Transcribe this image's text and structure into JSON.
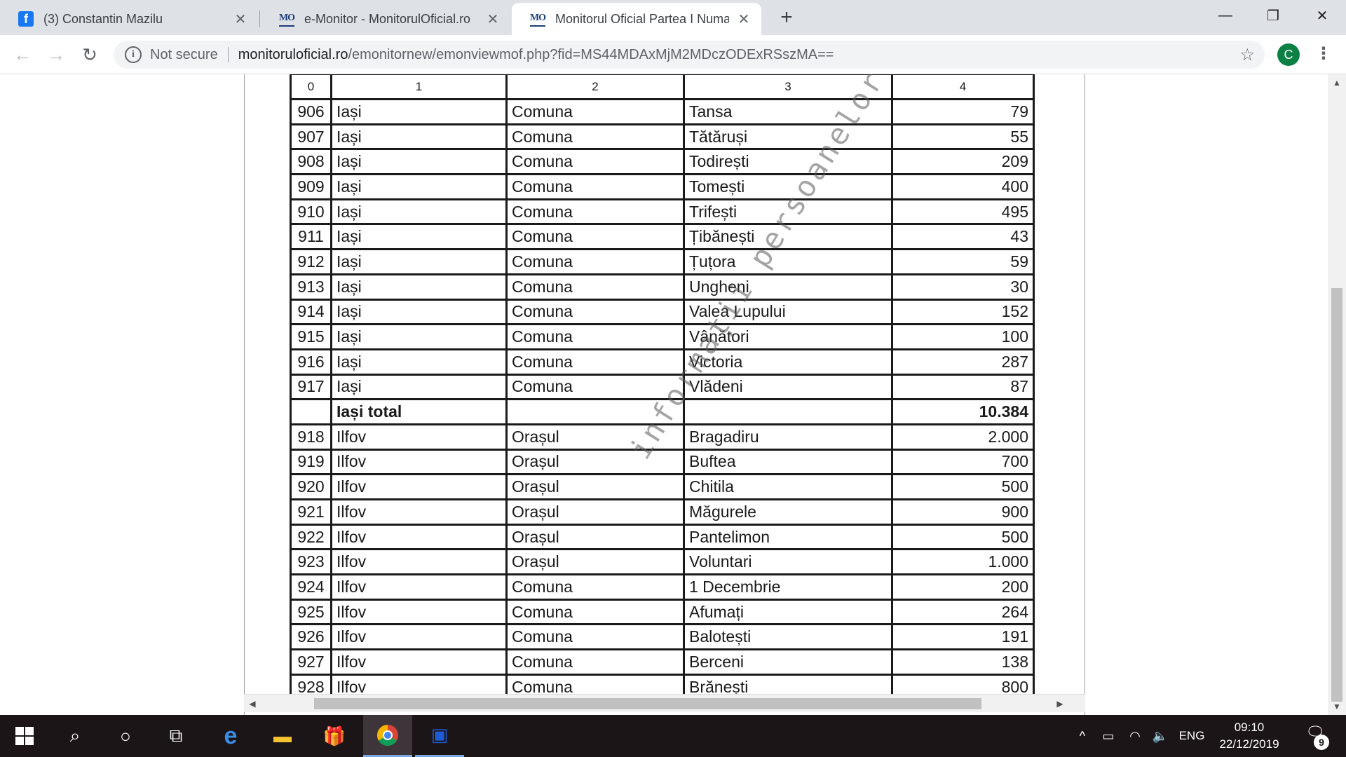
{
  "browser": {
    "tabs": [
      {
        "title": "(3) Constantin Mazilu",
        "icon": "facebook-icon",
        "active": false
      },
      {
        "title": "e-Monitor - MonitorulOficial.ro",
        "icon": "monitorul-oficial-icon",
        "active": false
      },
      {
        "title": "Monitorul Oficial Partea I Numar",
        "icon": "monitorul-oficial-icon",
        "active": true
      }
    ],
    "favicon_fb": "f",
    "favicon_mo": "MO",
    "new_tab": "+",
    "window_controls": {
      "minimize": "—",
      "restore": "❐",
      "close": "✕"
    },
    "toolbar": {
      "back": "←",
      "forward": "→",
      "reload": "↻",
      "security_icon": "i",
      "security_label": "Not secure",
      "url_domain": "monitoruloficial.ro",
      "url_path": "/emonitornew/emonviewmof.php?fid=MS44MDAxMjM2MDczODExRSszMA==",
      "bookmark": "☆",
      "profile_initial": "C",
      "menu": "⋮"
    }
  },
  "document": {
    "headers": [
      "0",
      "1",
      "2",
      "3",
      "4"
    ],
    "rows": [
      {
        "no": "906",
        "county": "Iași",
        "type": "Comuna",
        "locality": "Tansa",
        "value": "79"
      },
      {
        "no": "907",
        "county": "Iași",
        "type": "Comuna",
        "locality": "Tătăruși",
        "value": "55"
      },
      {
        "no": "908",
        "county": "Iași",
        "type": "Comuna",
        "locality": "Todirești",
        "value": "209"
      },
      {
        "no": "909",
        "county": "Iași",
        "type": "Comuna",
        "locality": "Tomești",
        "value": "400"
      },
      {
        "no": "910",
        "county": "Iași",
        "type": "Comuna",
        "locality": "Trifești",
        "value": "495"
      },
      {
        "no": "911",
        "county": "Iași",
        "type": "Comuna",
        "locality": "Țibănești",
        "value": "43"
      },
      {
        "no": "912",
        "county": "Iași",
        "type": "Comuna",
        "locality": "Țuțora",
        "value": "59"
      },
      {
        "no": "913",
        "county": "Iași",
        "type": "Comuna",
        "locality": "Ungheni",
        "value": "30"
      },
      {
        "no": "914",
        "county": "Iași",
        "type": "Comuna",
        "locality": "Valea Lupului",
        "value": "152"
      },
      {
        "no": "915",
        "county": "Iași",
        "type": "Comuna",
        "locality": "Vânători",
        "value": "100"
      },
      {
        "no": "916",
        "county": "Iași",
        "type": "Comuna",
        "locality": "Victoria",
        "value": "287"
      },
      {
        "no": "917",
        "county": "Iași",
        "type": "Comuna",
        "locality": "Vlădeni",
        "value": "87"
      },
      {
        "no": "",
        "county": "Iași total",
        "type": "",
        "locality": "",
        "value": "10.384",
        "total": true
      },
      {
        "no": "918",
        "county": "Ilfov",
        "type": "Orașul",
        "locality": "Bragadiru",
        "value": "2.000"
      },
      {
        "no": "919",
        "county": "Ilfov",
        "type": "Orașul",
        "locality": "Buftea",
        "value": "700"
      },
      {
        "no": "920",
        "county": "Ilfov",
        "type": "Orașul",
        "locality": "Chitila",
        "value": "500"
      },
      {
        "no": "921",
        "county": "Ilfov",
        "type": "Orașul",
        "locality": "Măgurele",
        "value": "900"
      },
      {
        "no": "922",
        "county": "Ilfov",
        "type": "Orașul",
        "locality": "Pantelimon",
        "value": "500"
      },
      {
        "no": "923",
        "county": "Ilfov",
        "type": "Orașul",
        "locality": "Voluntari",
        "value": "1.000"
      },
      {
        "no": "924",
        "county": "Ilfov",
        "type": "Comuna",
        "locality": "1 Decembrie",
        "value": "200"
      },
      {
        "no": "925",
        "county": "Ilfov",
        "type": "Comuna",
        "locality": "Afumați",
        "value": "264"
      },
      {
        "no": "926",
        "county": "Ilfov",
        "type": "Comuna",
        "locality": "Balotești",
        "value": "191"
      },
      {
        "no": "927",
        "county": "Ilfov",
        "type": "Comuna",
        "locality": "Berceni",
        "value": "138"
      },
      {
        "no": "928",
        "county": "Ilfov",
        "type": "Comuna",
        "locality": "Brănești",
        "value": "800"
      }
    ],
    "watermark": "informații persoanelor fizice"
  },
  "scrollbars": {
    "up": "▲",
    "down": "▼",
    "left": "◀",
    "right": "▶"
  },
  "taskbar": {
    "start_icon": "windows-start-icon",
    "search_glyph": "⌕",
    "cortana_glyph": "○",
    "taskview_glyph": "⧉",
    "edge_glyph": "e",
    "explorer_glyph": "▬",
    "gift_glyph": "🎁",
    "save_glyph": "▣",
    "tray_chevron": "^",
    "battery_glyph": "▭",
    "wifi_glyph": "◠",
    "volume_glyph": "🔈",
    "language": "ENG",
    "time": "09:10",
    "date": "22/12/2019",
    "notification_glyph": "🗨",
    "notification_count": "9"
  }
}
